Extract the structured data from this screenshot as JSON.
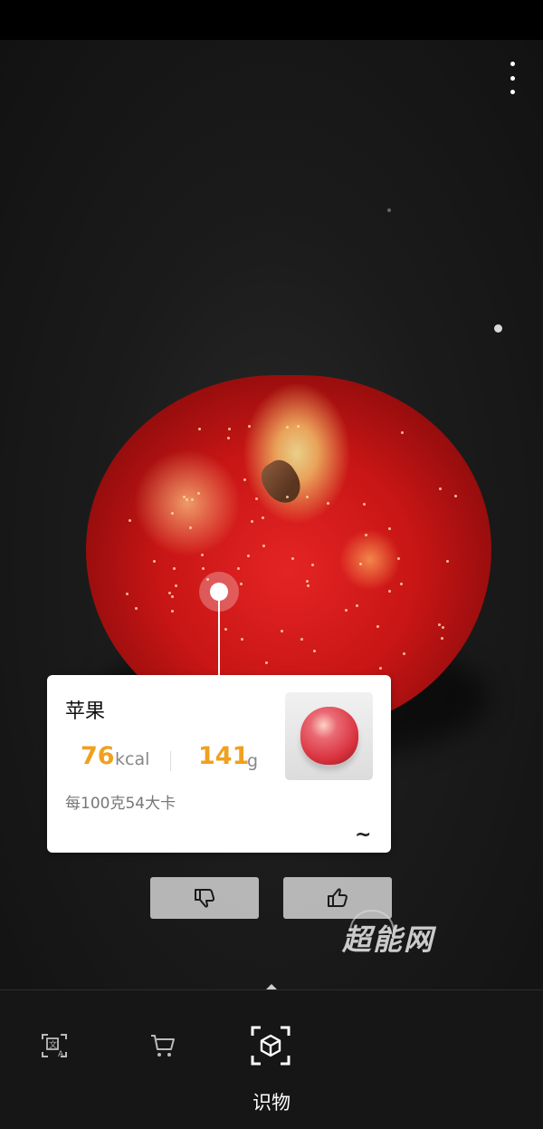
{
  "top_bar": {
    "menu_icon": "more-vert-icon"
  },
  "result": {
    "food_name": "苹果",
    "calories_value": "76",
    "calories_unit": "kcal",
    "weight_value": "141",
    "weight_unit": "g",
    "per_100g_text": "每100克54大卡",
    "expand_icon": "~"
  },
  "feedback": {
    "dislike_icon": "thumbs-down-icon",
    "like_icon": "thumbs-up-icon"
  },
  "watermark": {
    "text": "超能网"
  },
  "modes": {
    "items": [
      {
        "icon": "translate-scan-icon"
      },
      {
        "icon": "shopping-cart-icon"
      },
      {
        "icon": "object-recognition-icon"
      }
    ],
    "active_label": "识物"
  },
  "colors": {
    "accent": "#f0a020",
    "apple_red": "#d81e1e",
    "bar_bg": "#161616"
  }
}
